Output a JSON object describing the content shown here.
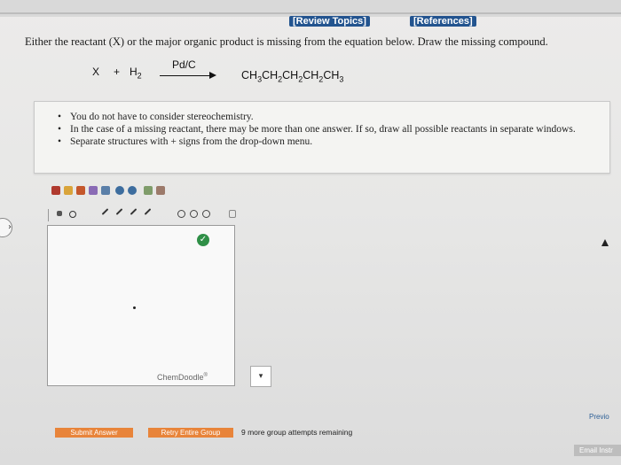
{
  "header": {
    "review_topics": "[Review Topics]",
    "references": "[References]"
  },
  "question": {
    "text": "Either the reactant (X) or the major organic product is missing from the equation below. Draw the missing compound."
  },
  "equation": {
    "reactant": "X",
    "plus": "+",
    "reagent": "H",
    "reagent_sub": "2",
    "catalyst": "Pd/C",
    "product_parts": [
      "CH",
      "3",
      "CH",
      "2",
      "CH",
      "2",
      "CH",
      "2",
      "CH",
      "3"
    ]
  },
  "notes": [
    "You do not have to consider stereochemistry.",
    "In the case of a missing reactant, there may be more than one answer. If so, draw all possible reactants in separate windows.",
    "Separate structures with + signs from the drop-down menu."
  ],
  "editor": {
    "brand": "ChemDoodle",
    "brand_mark": "®",
    "dropdown_symbol": "▾"
  },
  "actions": {
    "submit": "Submit Answer",
    "retry": "Retry Entire Group",
    "remaining": "9 more group attempts remaining"
  },
  "nav": {
    "previous": "Previo",
    "email": "Email Instr"
  },
  "colors": {
    "link_bg": "#23548f",
    "button_orange": "#e8843a",
    "check_green": "#2f8f47"
  }
}
